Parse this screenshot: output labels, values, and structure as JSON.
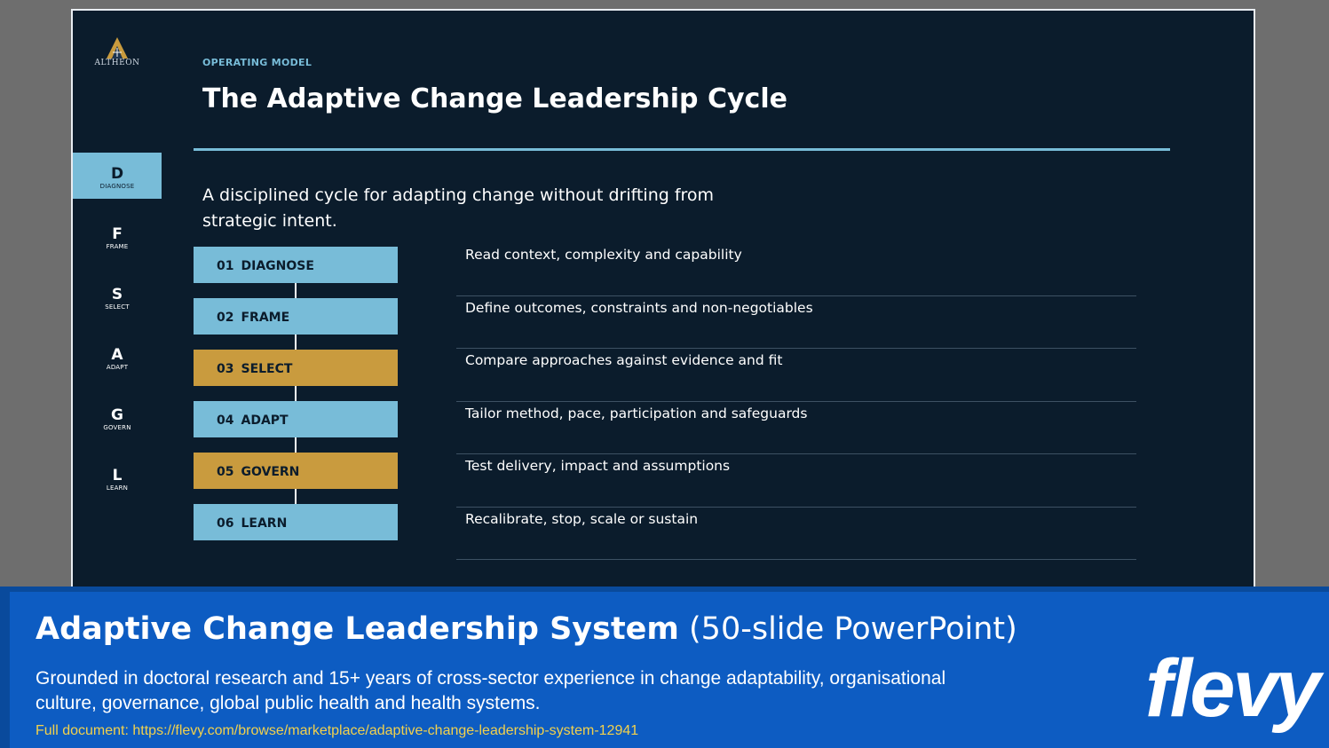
{
  "brand": {
    "logo_text": "ALTHEON"
  },
  "nav": [
    {
      "letter": "D",
      "word": "DIAGNOSE",
      "active": true
    },
    {
      "letter": "F",
      "word": "FRAME"
    },
    {
      "letter": "S",
      "word": "SELECT"
    },
    {
      "letter": "A",
      "word": "ADAPT"
    },
    {
      "letter": "G",
      "word": "GOVERN"
    },
    {
      "letter": "L",
      "word": "LEARN"
    }
  ],
  "slide": {
    "eyebrow": "OPERATING MODEL",
    "title": "The Adaptive Change Leadership Cycle",
    "subtitle": "A disciplined cycle for adapting change without drifting from strategic intent."
  },
  "steps": [
    {
      "num": "01",
      "label": "DIAGNOSE",
      "color": "#78bcd8",
      "desc": "Read context, complexity and capability"
    },
    {
      "num": "02",
      "label": "FRAME",
      "color": "#78bcd8",
      "desc": "Define outcomes, constraints and non-negotiables"
    },
    {
      "num": "03",
      "label": "SELECT",
      "color": "#c99b3e",
      "desc": "Compare approaches against evidence and fit"
    },
    {
      "num": "04",
      "label": "ADAPT",
      "color": "#78bcd8",
      "desc": "Tailor method, pace, participation and safeguards"
    },
    {
      "num": "05",
      "label": "GOVERN",
      "color": "#c99b3e",
      "desc": "Test delivery, impact and assumptions"
    },
    {
      "num": "06",
      "label": "LEARN",
      "color": "#78bcd8",
      "desc": "Recalibrate, stop, scale or sustain"
    }
  ],
  "banner": {
    "title_bold": "Adaptive Change Leadership System",
    "title_light": "(50-slide PowerPoint)",
    "description": "Grounded in doctoral research and 15+ years of cross-sector experience in change adaptability, organisational culture, governance, global public health and health systems.",
    "link": "Full document: https://flevy.com/browse/marketplace/adaptive-change-leadership-system-12941",
    "logo": "flevy"
  },
  "colors": {
    "slide_bg": "#0b1c2c",
    "accent_blue": "#78bcd8",
    "accent_gold": "#c99b3e",
    "banner_bg": "#0d5cc2",
    "link_yellow": "#f2d14c"
  }
}
